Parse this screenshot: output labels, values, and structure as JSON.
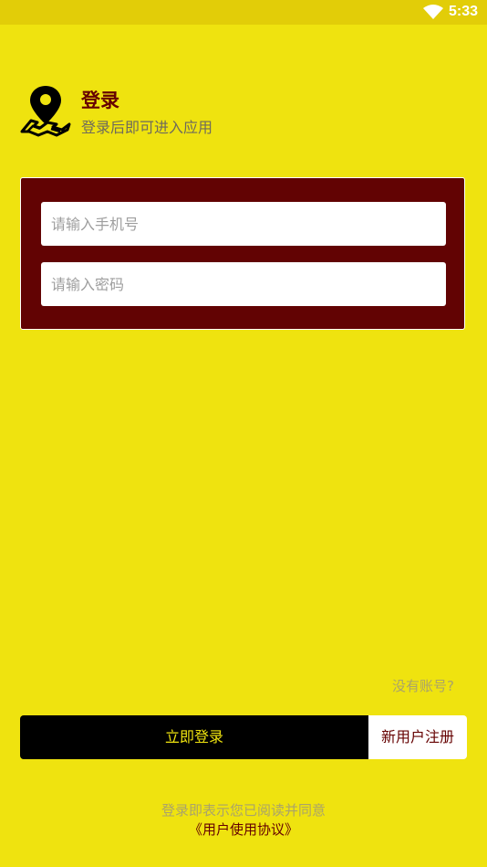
{
  "status_bar": {
    "time": "5:33",
    "wifi_icon": "wifi-icon"
  },
  "header": {
    "logo_icon": "map-pin-icon",
    "title": "登录",
    "subtitle": "登录后即可进入应用"
  },
  "form": {
    "phone_placeholder": "请输入手机号",
    "phone_value": "",
    "password_placeholder": "请输入密码",
    "password_value": ""
  },
  "no_account_text": "没有账号?",
  "buttons": {
    "login_label": "立即登录",
    "register_label": "新用户注册"
  },
  "agreement": {
    "note": "登录即表示您已阅读并同意",
    "link": "《用户使用协议》"
  },
  "colors": {
    "background": "#efe30f",
    "status_bar": "#e2cd08",
    "card": "#620303",
    "brand_dark": "#650101",
    "login_button": "#000000"
  }
}
